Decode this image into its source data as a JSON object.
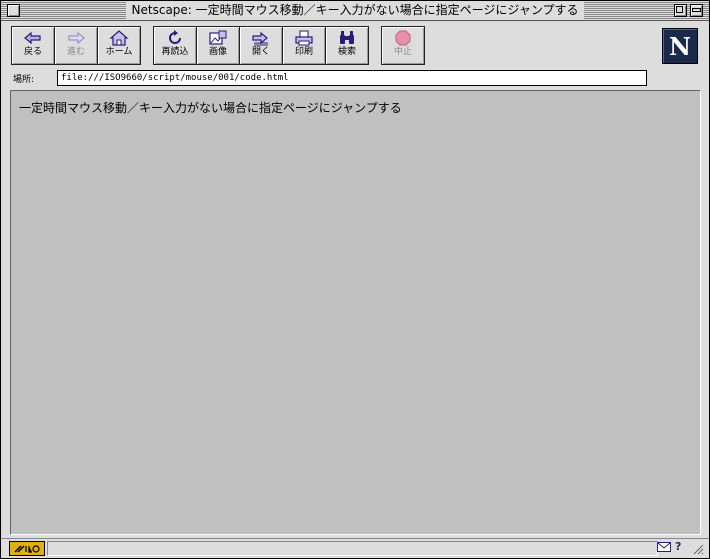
{
  "window": {
    "title": "Netscape: 一定時間マウス移動／キー入力がない場合に指定ページにジャンプする"
  },
  "toolbar": {
    "back_label": "戻る",
    "forward_label": "進む",
    "home_label": "ホーム",
    "reload_label": "再読込",
    "images_label": "画像",
    "open_label": "開く",
    "print_label": "印刷",
    "find_label": "検索",
    "stop_label": "中止"
  },
  "logo": {
    "letter": "N"
  },
  "location": {
    "label": "場所:",
    "url": "file:///ISO9660/script/mouse/001/code.html"
  },
  "content": {
    "text": "一定時間マウス移動／キー入力がない場合に指定ページにジャンプする"
  },
  "status": {
    "text": "",
    "help_glyph": "?"
  },
  "colors": {
    "chrome": "#dddddd",
    "content_bg": "#c0c0c0",
    "icon_accent": "#4a3aa0",
    "stop_red": "#e06080",
    "logo_bg": "#1a2a4a"
  }
}
